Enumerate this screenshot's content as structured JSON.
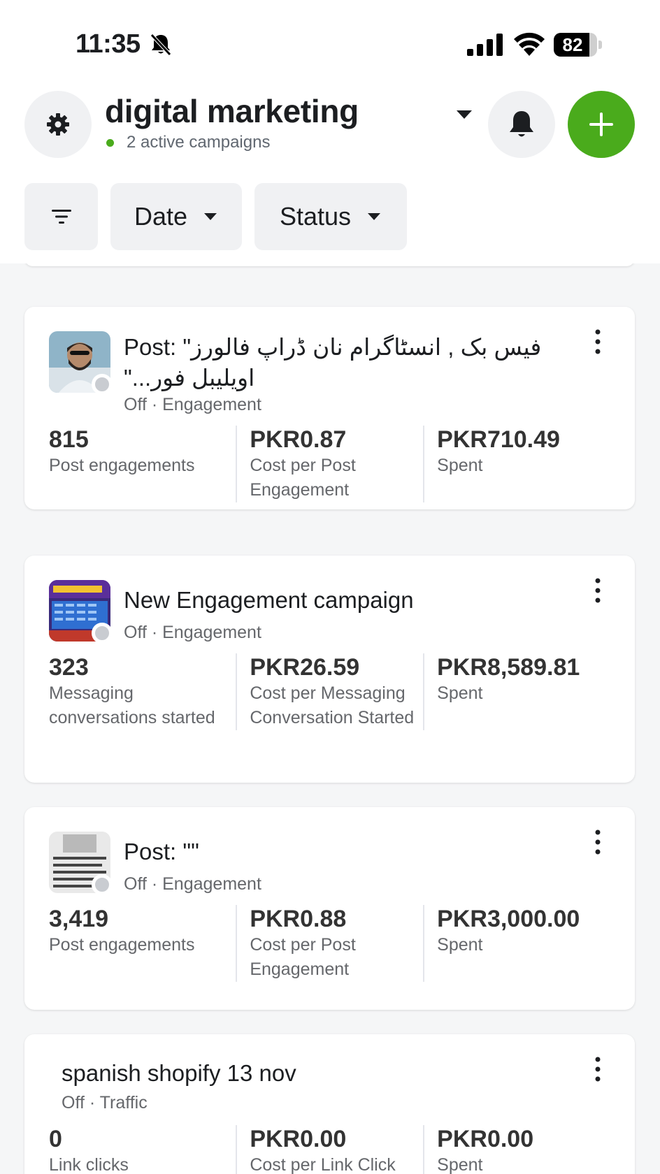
{
  "status_bar": {
    "time": "11:35",
    "battery_percent": "82",
    "battery_level": 0.82
  },
  "header": {
    "account_name": "digital marketing",
    "active_campaigns": "2 active campaigns",
    "accent_color": "#4aab1c"
  },
  "filters": {
    "date_label": "Date",
    "status_label": "Status"
  },
  "campaigns": [
    {
      "title_line1": "Post: \"فیس بک , انسٹاگرام نان ڈراپ فالورز",
      "title_line2": "اویلیبل فور...\"",
      "status": "Off",
      "objective": "Engagement",
      "metrics": [
        {
          "value": "815",
          "label": "Post engagements"
        },
        {
          "value": "PKR0.87",
          "label": "Cost per Post Engagement"
        },
        {
          "value": "PKR710.49",
          "label": "Spent"
        }
      ]
    },
    {
      "title_line1": "New Engagement campaign",
      "status": "Off",
      "objective": "Engagement",
      "metrics": [
        {
          "value": "323",
          "label": "Messaging conversations started"
        },
        {
          "value": "PKR26.59",
          "label": "Cost per Messaging Conversation Started"
        },
        {
          "value": "PKR8,589.81",
          "label": "Spent"
        }
      ]
    },
    {
      "title_line1": "Post: \"\"",
      "status": "Off",
      "objective": "Engagement",
      "metrics": [
        {
          "value": "3,419",
          "label": "Post engagements"
        },
        {
          "value": "PKR0.88",
          "label": "Cost per Post Engagement"
        },
        {
          "value": "PKR3,000.00",
          "label": "Spent"
        }
      ]
    },
    {
      "title_line1": "spanish shopify 13 nov",
      "status": "Off",
      "objective": "Traffic",
      "metrics": [
        {
          "value": "0",
          "label": "Link clicks"
        },
        {
          "value": "PKR0.00",
          "label": "Cost per Link Click"
        },
        {
          "value": "PKR0.00",
          "label": "Spent"
        }
      ]
    }
  ]
}
